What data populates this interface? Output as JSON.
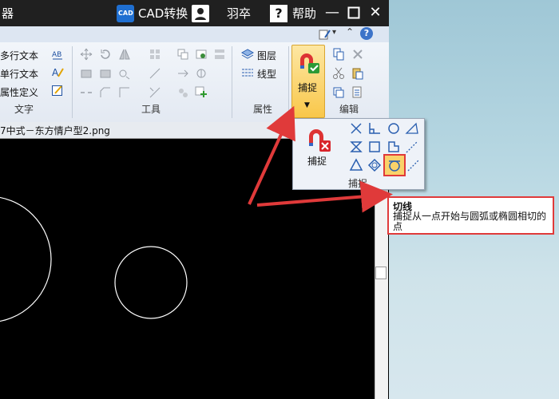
{
  "titlebar": {
    "app_title_fragment": "器",
    "cad_convert": "CAD转换",
    "user": "羽卒",
    "help": "帮助",
    "cad_badge": "CAD"
  },
  "ribbon": {
    "text_group": {
      "items": [
        "多行文本",
        "单行文本",
        "属性定义"
      ],
      "label": "文字"
    },
    "tools_group": {
      "label": "工具"
    },
    "property_group": {
      "items": [
        "图层",
        "线型"
      ],
      "label": "属性"
    },
    "snap_button": {
      "label": "捕捉"
    },
    "edit_group": {
      "label": "编辑"
    }
  },
  "document": {
    "tab_title": "7中式－东方情户型2.png"
  },
  "snap_popup": {
    "button_label": "捕捉",
    "group_label": "捕捉"
  },
  "tooltip": {
    "title": "切线",
    "description": "捕捉从一点开始与圆弧或椭圆相切的点"
  },
  "colors": {
    "highlight": "#e03a3a",
    "snap_button_bg": "#fbd66c",
    "canvas_bg": "#000000"
  }
}
